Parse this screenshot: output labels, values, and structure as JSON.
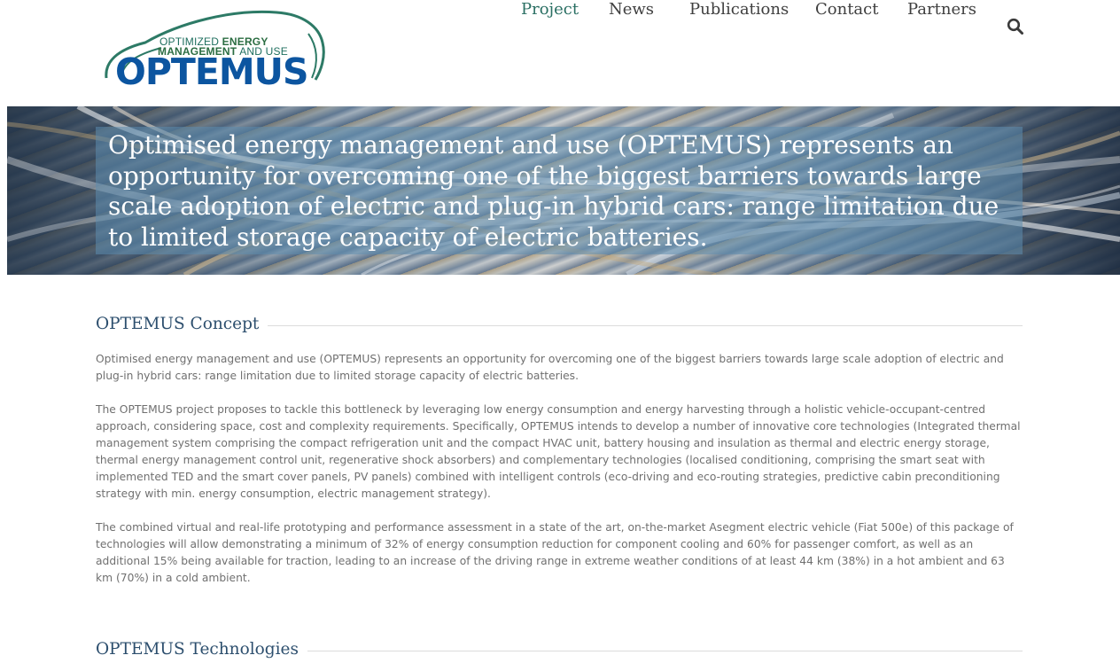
{
  "logo": {
    "line1_light": "OPTIMIZED ",
    "line1_bold": "ENERGY",
    "line2_bold": "MANAGEMENT",
    "line2_light": " AND USE",
    "wordmark": "OPTEMUS"
  },
  "nav": {
    "items": [
      {
        "label": "Project",
        "active": true
      },
      {
        "label": "News",
        "active": false
      },
      {
        "label": "Publications",
        "active": false
      },
      {
        "label": "Contact",
        "active": false
      },
      {
        "label": "Partners",
        "active": false
      }
    ],
    "search_icon": "search-icon"
  },
  "banner": {
    "text": "Optimised energy management and use (OPTEMUS) represents an opportunity for overcoming one of the biggest barriers towards large scale adoption of electric and plug-in hybrid cars: range limitation due to limited storage capacity of electric batteries."
  },
  "sections": {
    "concept": {
      "title": "OPTEMUS Concept",
      "paragraphs": [
        "Optimised energy management and use (OPTEMUS) represents an opportunity for overcoming one of the biggest barriers towards large scale adoption of electric and plug-in hybrid cars: range limitation due to limited storage capacity of electric batteries.",
        "The OPTEMUS project proposes to tackle this bottleneck by leveraging low energy consumption and energy harvesting through a holistic vehicle-occupant-centred approach, considering space, cost and complexity requirements. Specifically, OPTEMUS intends to develop a number of innovative core technologies (Integrated thermal management system comprising the compact refrigeration unit and the compact HVAC unit, battery housing and insulation as thermal and electric energy storage, thermal energy management control unit, regenerative shock absorbers) and complementary technologies (localised conditioning, comprising the smart seat with implemented TED and the smart cover panels, PV panels) combined with intelligent controls (eco-driving and eco-routing strategies, predictive cabin preconditioning strategy with min. energy consumption, electric management strategy).",
        "The combined virtual and real-life prototyping and performance assessment in a state of the art, on-the-market Asegment electric vehicle (Fiat 500e) of this package of technologies will allow demonstrating a minimum of 32% of energy consumption reduction for component cooling and 60% for passenger comfort, as well as an additional 15% being available for traction, leading to an increase of the driving range in extreme weather conditions of at least 44 km (38%) in a hot ambient and 63 km (70%) in a cold ambient."
      ]
    },
    "technologies": {
      "title": "OPTEMUS Technologies"
    }
  },
  "colors": {
    "nav_active": "#2a6f63",
    "section_title": "#2d4f6e",
    "logo_blue": "#0c55a0",
    "logo_green": "#2b6d42"
  }
}
